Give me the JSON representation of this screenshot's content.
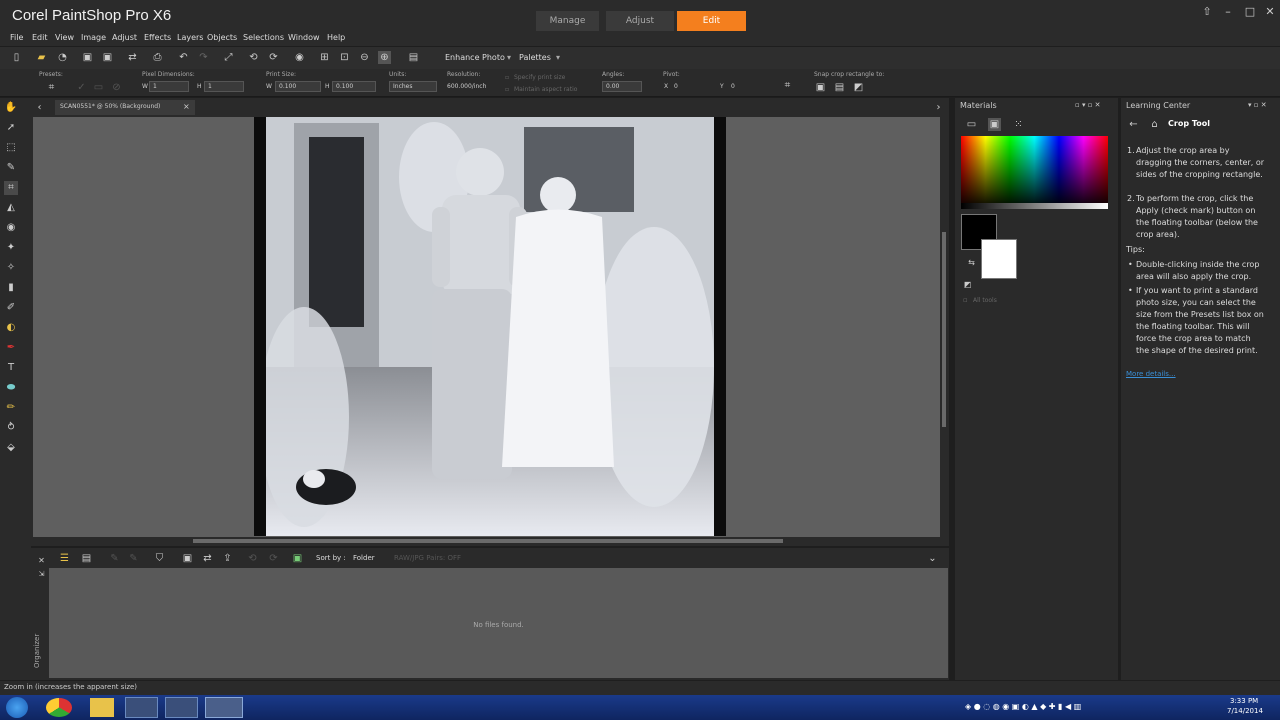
{
  "app": {
    "title": "Corel PaintShop Pro X6"
  },
  "workspace_tabs": [
    {
      "label": "Manage"
    },
    {
      "label": "Adjust"
    },
    {
      "label": "Edit"
    }
  ],
  "menu": [
    "File",
    "Edit",
    "View",
    "Image",
    "Adjust",
    "Effects",
    "Layers",
    "Objects",
    "Selections",
    "Window",
    "Help"
  ],
  "toolbar": {
    "enhance_photo": "Enhance Photo",
    "palettes": "Palettes"
  },
  "options": {
    "presets_label": "Presets:",
    "pixel_dim_label": "Pixel Dimensions:",
    "w_value": "1",
    "h_value": "1",
    "print_size_label": "Print Size:",
    "print_w": "0.100",
    "print_h": "0.100",
    "units_label": "Units:",
    "units_value": "Inches",
    "resolution_label": "Resolution:",
    "resolution_value": "600.000/inch",
    "specify_print_size": "Specify print size",
    "maintain_aspect": "Maintain aspect ratio",
    "angle_label": "Angles:",
    "angle_value": "0.00",
    "pivot_label": "Pivot:",
    "pivot_x": "0",
    "pivot_y": "0",
    "snap_label": "Snap crop rectangle to:"
  },
  "document": {
    "tab_title": "SCAN0551* @ 50% (Background)"
  },
  "organizer": {
    "sort_label": "Sort by :",
    "sort_value": "Folder",
    "raw_pairs": "RAW/JPG Pairs: OFF",
    "empty_message": "No files found.",
    "side_label": "Organizer"
  },
  "materials": {
    "title": "Materials",
    "all_tools": "All tools"
  },
  "learning_center": {
    "title": "Learning Center",
    "tool_name": "Crop Tool",
    "steps": [
      {
        "num": "1.",
        "text": "Adjust the crop area by dragging the corners, center, or sides of the cropping rectangle."
      },
      {
        "num": "2.",
        "text": "To perform the crop, click the Apply (check mark) button on the floating toolbar (below the crop area)."
      }
    ],
    "tips_label": "Tips:",
    "tips": [
      "Double-clicking inside the crop area will also apply the crop.",
      "If you want to print a standard photo size, you can select the size from the Presets list box on the floating toolbar. This will force the crop area to match the shape of the desired print."
    ],
    "more_details": "More details..."
  },
  "status": {
    "text": "Zoom in (increases the apparent size)"
  },
  "taskbar": {
    "time": "3:33 PM",
    "date": "7/14/2014"
  },
  "colors": {
    "accent": "#f47f1e"
  }
}
